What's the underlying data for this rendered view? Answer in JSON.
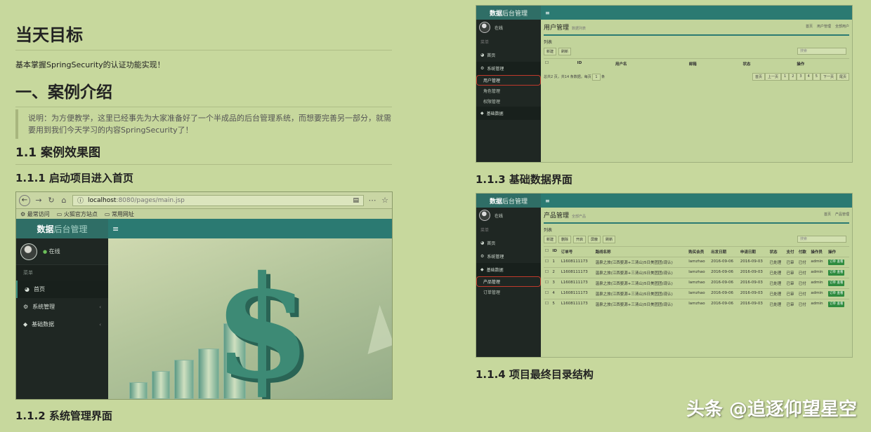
{
  "doc": {
    "h1": "当天目标",
    "goal_text": "基本掌握SpringSecurity的认证功能实现！",
    "h2": "一、案例介绍",
    "note": "说明：为方便教学，这里已经事先为大家准备好了一个半成品的后台管理系统，而想要完善另一部分，就需要用到我们今天学习的内容SpringSecurity了！",
    "h3": "1.1 案例效果图",
    "h4_1": "1.1.1 启动项目进入首页",
    "h4_2": "1.1.2 系统管理界面",
    "h4_3": "1.1.3 基础数据界面",
    "h4_4": "1.1.4 项目最终目录结构"
  },
  "browser": {
    "url_host": "localhost",
    "url_path": ":8080/pages/main.jsp",
    "bookmarks": [
      "最常访问",
      "火狐官方站点",
      "常用网址"
    ]
  },
  "app": {
    "logo_bold": "数据",
    "logo_rest": "后台管理",
    "user_status": "在线",
    "menu_header": "菜单",
    "menu": [
      {
        "label": "首页",
        "icon": "dashboard-icon"
      },
      {
        "label": "系统管理",
        "icon": "cogs-icon"
      },
      {
        "label": "基础数据",
        "icon": "cube-icon"
      }
    ]
  },
  "shot1": {
    "title": "用户管理",
    "subtitle": "数据列表",
    "crumbs": [
      "首页",
      "用户管理",
      "全部用户"
    ],
    "section": "列表",
    "buttons": [
      "新建",
      "刷新"
    ],
    "search_placeholder": "搜索",
    "columns": [
      "ID",
      "用户名",
      "邮箱",
      "状态",
      "操作"
    ],
    "submenu": [
      "用户管理",
      "角色管理",
      "权限管理"
    ],
    "footer_left": "总共2 页，共14 条数据。每页",
    "footer_unit": "条",
    "page_size": "1",
    "pager": [
      "首页",
      "上一页",
      "1",
      "2",
      "3",
      "4",
      "5",
      "下一页",
      "尾页"
    ]
  },
  "shot2": {
    "title": "产品管理",
    "subtitle": "全部产品",
    "crumbs": [
      "首页",
      "产品管理"
    ],
    "section": "列表",
    "buttons": [
      "新建",
      "删除",
      "开启",
      "屏蔽",
      "刷新"
    ],
    "search_placeholder": "搜索",
    "columns": [
      "ID",
      "订单号",
      "路线名称",
      "购买会员",
      "出发日期",
      "申请日期",
      "状态",
      "支付",
      "付款",
      "操作员",
      "操作"
    ],
    "submenu": [
      "产品管理",
      "订单管理"
    ],
    "row_template": {
      "order": "L1608111173",
      "route": "温泉之旅(江西婺源+三清山)5日美团团(现认)",
      "member": "lamzhao",
      "depart": "2016-09-06",
      "apply": "2016-09-03",
      "status": "已处理",
      "pay": "已审",
      "paid": "已付",
      "operator": "admin",
      "op_btn": "订单 查看"
    },
    "row_ids": [
      "1",
      "2",
      "3",
      "4",
      "5"
    ]
  },
  "watermark": "头条 @追逐仰望星空"
}
